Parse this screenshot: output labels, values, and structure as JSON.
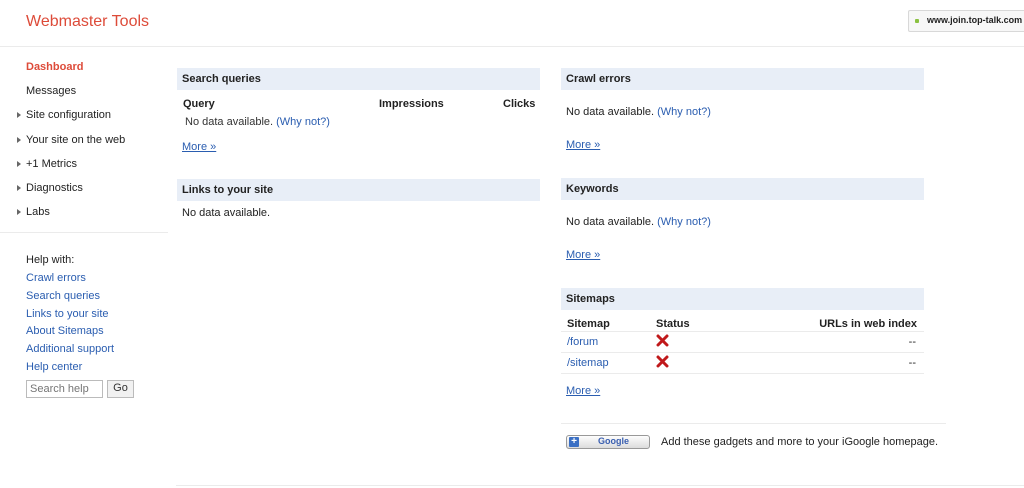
{
  "header": {
    "title": "Webmaster Tools",
    "site_url": "www.join.top-talk.com"
  },
  "sidebar": {
    "items": [
      {
        "label": "Dashboard"
      },
      {
        "label": "Messages"
      },
      {
        "label": "Site configuration"
      },
      {
        "label": "Your site on the web"
      },
      {
        "label": "+1 Metrics"
      },
      {
        "label": "Diagnostics"
      },
      {
        "label": "Labs"
      }
    ],
    "help_title": "Help with:",
    "help_links": [
      "Crawl errors",
      "Search queries",
      "Links to your site",
      "About Sitemaps",
      "Additional support",
      "Help center"
    ],
    "search_placeholder": "Search help",
    "go_label": "Go"
  },
  "search_queries": {
    "title": "Search queries",
    "columns": [
      "Query",
      "Impressions",
      "Clicks"
    ],
    "no_data": "No data available.",
    "why_not": "(Why not?)",
    "more": "More »"
  },
  "links_to_site": {
    "title": "Links to your site",
    "no_data": "No data available."
  },
  "crawl_errors": {
    "title": "Crawl errors",
    "no_data": "No data available.",
    "why_not": "(Why not?)",
    "more": "More »"
  },
  "keywords": {
    "title": "Keywords",
    "no_data": "No data available.",
    "why_not": "(Why not?)",
    "more": "More »"
  },
  "sitemaps": {
    "title": "Sitemaps",
    "columns": [
      "Sitemap",
      "Status",
      "URLs in web index"
    ],
    "rows": [
      {
        "sitemap": "/forum",
        "status": "error-icon",
        "urls": "--"
      },
      {
        "sitemap": "/sitemap",
        "status": "error-icon",
        "urls": "--"
      }
    ],
    "more": "More »"
  },
  "igoogle": {
    "button_label": "Google",
    "text": "Add these gadgets and more to your iGoogle homepage."
  },
  "colors": {
    "brand": "#dd4b39",
    "link": "#2a5db0",
    "panel_header": "#e8eef7"
  }
}
